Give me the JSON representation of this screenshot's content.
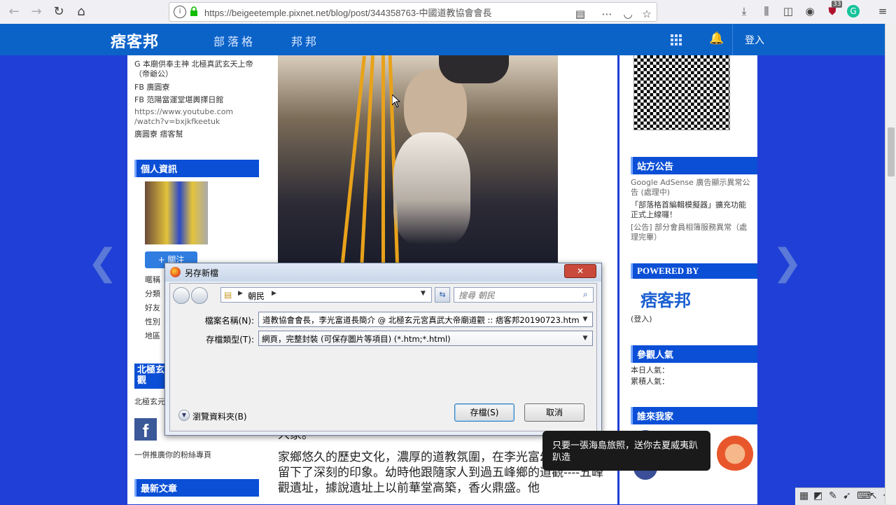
{
  "browser": {
    "url": "https://beigeetemple.pixnet.net/blog/post/344358763-中國道教協會會長",
    "badge_count": "33"
  },
  "site_header": {
    "logo": "痞客邦",
    "nav": [
      "部落格",
      "邦邦"
    ],
    "login": "登入"
  },
  "left_sidebar": {
    "links": [
      "G 本廟供奉主神 北極真武玄天上帝",
      "（帝爺公）",
      "FB 廣圓寮",
      "FB 范陽當運堂堪輿擇日館",
      "https://www.youtube.com",
      "/watch?v=bxjkfkeetuk",
      "廣圓寮 痞客幫"
    ],
    "profile_title": "個人資訊",
    "follow_label": "+ 關注",
    "info_labels": [
      "暱稱",
      "分類",
      "好友",
      "性別",
      "地區"
    ],
    "north_title": "北極玄",
    "north_title_2": "觀",
    "north_text": "北極玄元",
    "fb_promo": "一併推廣你的粉絲專頁",
    "latest_title": "最新文章"
  },
  "article": {
    "line1": "人家。",
    "para": "家鄉悠久的歷史文化，濃厚的道教氛圍，在李光富幼小的心靈裡留下了深刻的印象。幼時他跟隨家人到過五峰鄉的道觀----五峰觀遺址，據說遺址上以前華堂高築，香火鼎盛。他"
  },
  "right_sidebar": {
    "announcement_title": "站方公告",
    "announcements": [
      "Google AdSense 廣告顯示異常公",
      "告 (處理中)",
      "「部落格首編輯模擬器」擴充功能",
      "正式上線囉！",
      "[公告] 部分會員相簿服務異常（處",
      "理完畢）"
    ],
    "powered_title": "POWERED BY",
    "powered_logo": "痞客邦",
    "powered_login": "(登入)",
    "popularity_title": "參觀人氣",
    "today_label": "本日人氣：",
    "total_label": "累積人氣：",
    "visitors_title": "誰來我家"
  },
  "dialog": {
    "title": "另存新檔",
    "close_label": "✕",
    "breadcrumb": "朝民",
    "search_placeholder": "搜尋 朝民",
    "filename_label": "檔案名稱(N):",
    "filename_value": "道教協會會長，李光富道長簡介 @ 北極玄元宮真武大帝廟道觀 :: 痞客邦20190723.htm",
    "filetype_label": "存檔類型(T):",
    "filetype_value": "網頁，完整封裝 (可保存圖片等項目) (*.htm;*.html)",
    "browse_folders": "瀏覽資料夾(B)",
    "save_button": "存檔(S)",
    "cancel_button": "取消"
  },
  "toast": {
    "text": "只要一張海島旅照，送你去夏威夷趴趴造"
  },
  "colors": {
    "site_header": "#0b63c8",
    "page_background": "#1f3fd6",
    "widget_title": "#0b4fd6",
    "dialog_bg": "#e9eef6"
  }
}
